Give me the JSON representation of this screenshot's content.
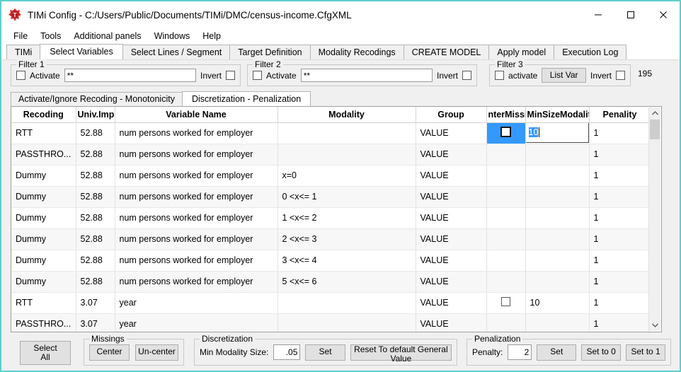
{
  "window": {
    "title": "TIMi Config - C:/Users/Public/Documents/TIMi/DMC/census-income.CfgXML",
    "minimize_label": "minimize",
    "maximize_label": "maximize",
    "close_label": "close",
    "accent": "#5ecfcf"
  },
  "menu": {
    "items": [
      "File",
      "Tools",
      "Additional panels",
      "Windows",
      "Help"
    ]
  },
  "main_tabs": {
    "items": [
      {
        "label": "TIMi",
        "active": false
      },
      {
        "label": "Select Variables",
        "active": true
      },
      {
        "label": "Select Lines / Segment",
        "active": false
      },
      {
        "label": "Target Definition",
        "active": false
      },
      {
        "label": "Modality Recodings",
        "active": false
      },
      {
        "label": "CREATE MODEL",
        "active": false
      },
      {
        "label": "Apply model",
        "active": false
      },
      {
        "label": "Execution Log",
        "active": false
      }
    ]
  },
  "filters": {
    "filter1": {
      "title": "Filter 1",
      "activate_label": "Activate",
      "activate_checked": false,
      "value": "**",
      "invert_label": "Invert",
      "invert_checked": false
    },
    "filter2": {
      "title": "Filter 2",
      "activate_label": "Activate",
      "activate_checked": false,
      "value": "**",
      "invert_label": "Invert",
      "invert_checked": false
    },
    "filter3": {
      "title": "Filter 3",
      "activate_label": "activate",
      "activate_checked": false,
      "list_var_label": "List Var",
      "invert_label": "Invert",
      "invert_checked": false
    },
    "variable_count": "195"
  },
  "sub_tabs": {
    "items": [
      {
        "label": "Activate/Ignore Recoding - Monotonicity",
        "active": false
      },
      {
        "label": "Discretization - Penalization",
        "active": true
      }
    ]
  },
  "grid": {
    "columns": [
      "Recoding",
      "Univ.Imp.",
      "Variable Name",
      "Modality",
      "Group",
      "nterMissi",
      "MinSizeModalit",
      "Penality"
    ],
    "rows": [
      {
        "recoding": "RTT",
        "univ_imp": "52.88",
        "variable_name": "num persons worked for employer",
        "modality": "",
        "group": "VALUE",
        "center_missing": "checkbox",
        "min_size_modality": "10",
        "penality": "1",
        "selected": true,
        "editing": true
      },
      {
        "recoding": "PASSTHRO...",
        "univ_imp": "52.88",
        "variable_name": "num persons worked for employer",
        "modality": "",
        "group": "VALUE",
        "center_missing": "",
        "min_size_modality": "",
        "penality": "1"
      },
      {
        "recoding": "Dummy",
        "univ_imp": "52.88",
        "variable_name": "num persons worked for employer",
        "modality": "x=0",
        "group": "VALUE",
        "center_missing": "",
        "min_size_modality": "",
        "penality": "1"
      },
      {
        "recoding": "Dummy",
        "univ_imp": "52.88",
        "variable_name": "num persons worked for employer",
        "modality": "0 <x<= 1",
        "group": "VALUE",
        "center_missing": "",
        "min_size_modality": "",
        "penality": "1"
      },
      {
        "recoding": "Dummy",
        "univ_imp": "52.88",
        "variable_name": "num persons worked for employer",
        "modality": "1 <x<= 2",
        "group": "VALUE",
        "center_missing": "",
        "min_size_modality": "",
        "penality": "1"
      },
      {
        "recoding": "Dummy",
        "univ_imp": "52.88",
        "variable_name": "num persons worked for employer",
        "modality": "2 <x<= 3",
        "group": "VALUE",
        "center_missing": "",
        "min_size_modality": "",
        "penality": "1"
      },
      {
        "recoding": "Dummy",
        "univ_imp": "52.88",
        "variable_name": "num persons worked for employer",
        "modality": "3 <x<= 4",
        "group": "VALUE",
        "center_missing": "",
        "min_size_modality": "",
        "penality": "1"
      },
      {
        "recoding": "Dummy",
        "univ_imp": "52.88",
        "variable_name": "num persons worked for employer",
        "modality": "5 <x<= 6",
        "group": "VALUE",
        "center_missing": "",
        "min_size_modality": "",
        "penality": "1"
      },
      {
        "recoding": "RTT",
        "univ_imp": "3.07",
        "variable_name": "year",
        "modality": "",
        "group": "VALUE",
        "center_missing": "checkbox",
        "min_size_modality": "10",
        "penality": "1"
      },
      {
        "recoding": "PASSTHRO...",
        "univ_imp": "3.07",
        "variable_name": "year",
        "modality": "",
        "group": "VALUE",
        "center_missing": "",
        "min_size_modality": "",
        "penality": "1"
      }
    ],
    "edit_value": "10",
    "selection_color": "#3399ff"
  },
  "bottom": {
    "select_all_label": "Select\nAll",
    "select_all_line1": "Select",
    "select_all_line2": "All",
    "missings": {
      "title": "Missings",
      "center_label": "Center",
      "uncenter_label": "Un-center"
    },
    "discretization": {
      "title": "Discretization",
      "min_modality_label": "Min Modality Size:",
      "min_modality_value": ".05",
      "set_label": "Set",
      "reset_label": "Reset To default General Value"
    },
    "penalization": {
      "title": "Penalization",
      "penalty_label": "Penalty:",
      "penalty_value": "2",
      "set_label": "Set",
      "set_to_0_label": "Set to 0",
      "set_to_1_label": "Set to 1"
    }
  }
}
